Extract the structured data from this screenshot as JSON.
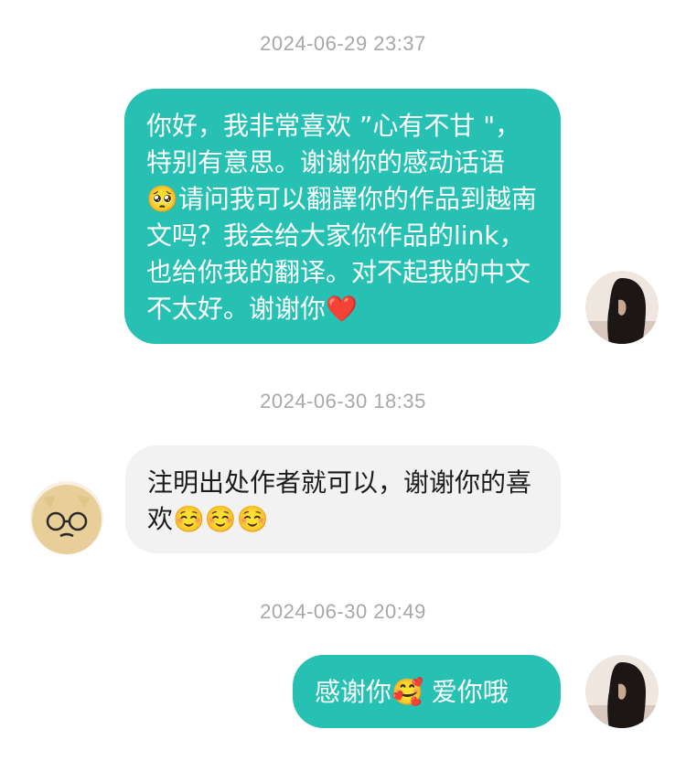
{
  "conversation": {
    "timestamps": [
      "2024-06-29 23:37",
      "2024-06-30 18:35",
      "2024-06-30 20:49"
    ],
    "messages": [
      {
        "sender": "self",
        "text": "你好，我非常喜欢 ”心有不甘 \"，特别有意思。谢谢你的感动话语 🥺请问我可以翻譯你的作品到越南文吗？我会给大家你作品的link，也给你我的翻译。对不起我的中文不太好。谢谢你❤️"
      },
      {
        "sender": "other",
        "text": "注明出处作者就可以，谢谢你的喜欢☺️☺️☺️"
      },
      {
        "sender": "self",
        "text": "感谢你🥰 爱你哦"
      }
    ]
  },
  "colors": {
    "outgoing_bubble": "#26c1b2",
    "incoming_bubble": "#f2f2f2",
    "timestamp_text": "#a8a8a8"
  },
  "icons": {
    "self_avatar": "avatar-photo-icon",
    "other_avatar": "cartoon-face-avatar-icon"
  }
}
